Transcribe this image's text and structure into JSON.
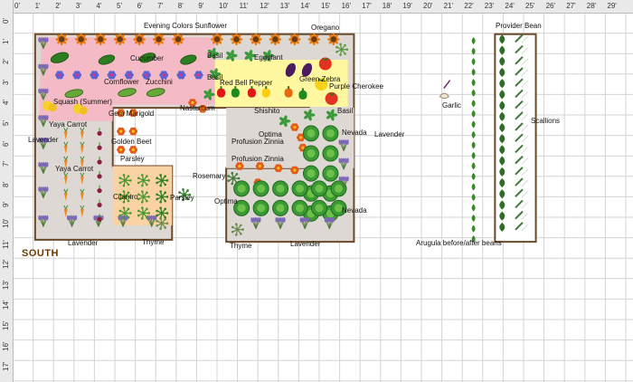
{
  "rulers": {
    "top": [
      "0'",
      "1'",
      "2'",
      "3'",
      "4'",
      "5'",
      "6'",
      "7'",
      "8'",
      "9'",
      "10'",
      "11'",
      "12'",
      "13'",
      "14'",
      "15'",
      "16'",
      "17'",
      "18'",
      "19'",
      "20'",
      "21'",
      "22'",
      "23'",
      "24'",
      "25'",
      "26'",
      "27'",
      "28'",
      "29'"
    ],
    "left": [
      "0'",
      "1'",
      "2'",
      "3'",
      "4'",
      "5'",
      "6'",
      "7'",
      "8'",
      "9'",
      "10'",
      "11'",
      "12'",
      "13'",
      "14'",
      "15'",
      "16'",
      "17'"
    ]
  },
  "orientation": "SOUTH",
  "labels": {
    "evening_colors": "Evening Colors Sunflower",
    "oregano": "Oregano",
    "cucumber": "Cucumber",
    "basil_1": "Basil",
    "eggplant": "Eggplant",
    "cornflower": "Cornflower",
    "zucchini": "Zucchini",
    "basil_2": "Basil",
    "red_bell": "Red Bell Pepper",
    "green_zebra": "Green Zebra",
    "purple_cherokee": "Purple Cherokee",
    "squash": "Squash (Summer)",
    "nasturtium": "Nasturtium",
    "shishito": "Shishito",
    "basil_3": "Basil",
    "yaya_carrot_1": "Yaya Carrot",
    "gem_marigold": "Gem Marigold",
    "lavender_left": "Lavender",
    "golden_beet": "Golden Beet",
    "optima_1": "Optima",
    "nevada_1": "Nevada",
    "lavender_right": "Lavender",
    "profusion_1": "Profusion Zinnia",
    "yaya_carrot_2": "Yaya Carrot",
    "parsley_1": "Parsley",
    "profusion_2": "Profusion Zinnia",
    "rosemary": "Rosemary",
    "cilantro": "Cilantro",
    "parsley_2": "Parsley",
    "optima_2": "Optima",
    "nevada_2": "Nevada",
    "lavender_bottom_1": "Lavender",
    "thyme_1": "Thyme",
    "thyme_2": "Thyme",
    "lavender_bottom_2": "Lavender",
    "garlic": "Garlic",
    "provider_bean": "Provider Bean",
    "scallions": "Scallions",
    "arugula": "Arugula before/after beans"
  },
  "colors": {
    "border": "#6b4a2a",
    "bed_fill": "#ddd8d4",
    "pink": "#f6b8c4",
    "yellow": "#fff8a0",
    "orange": "#fbd2a4",
    "grid": "#d4d4d4",
    "lettuce": "#3c9a35",
    "tomato": "#e23221",
    "lavender": "#7b67b5"
  },
  "icons": [
    "sunflower-icon",
    "cucumber-icon",
    "cornflower-icon",
    "zucchini-icon",
    "squash-icon",
    "carrot-icon",
    "beet-icon",
    "lavender-icon",
    "basil-icon",
    "eggplant-icon",
    "pepper-icon",
    "tomato-icon",
    "zinnia-icon",
    "lettuce-icon",
    "rosemary-icon",
    "cilantro-icon",
    "parsley-icon",
    "thyme-icon",
    "garlic-icon",
    "bean-icon",
    "scallion-icon"
  ]
}
